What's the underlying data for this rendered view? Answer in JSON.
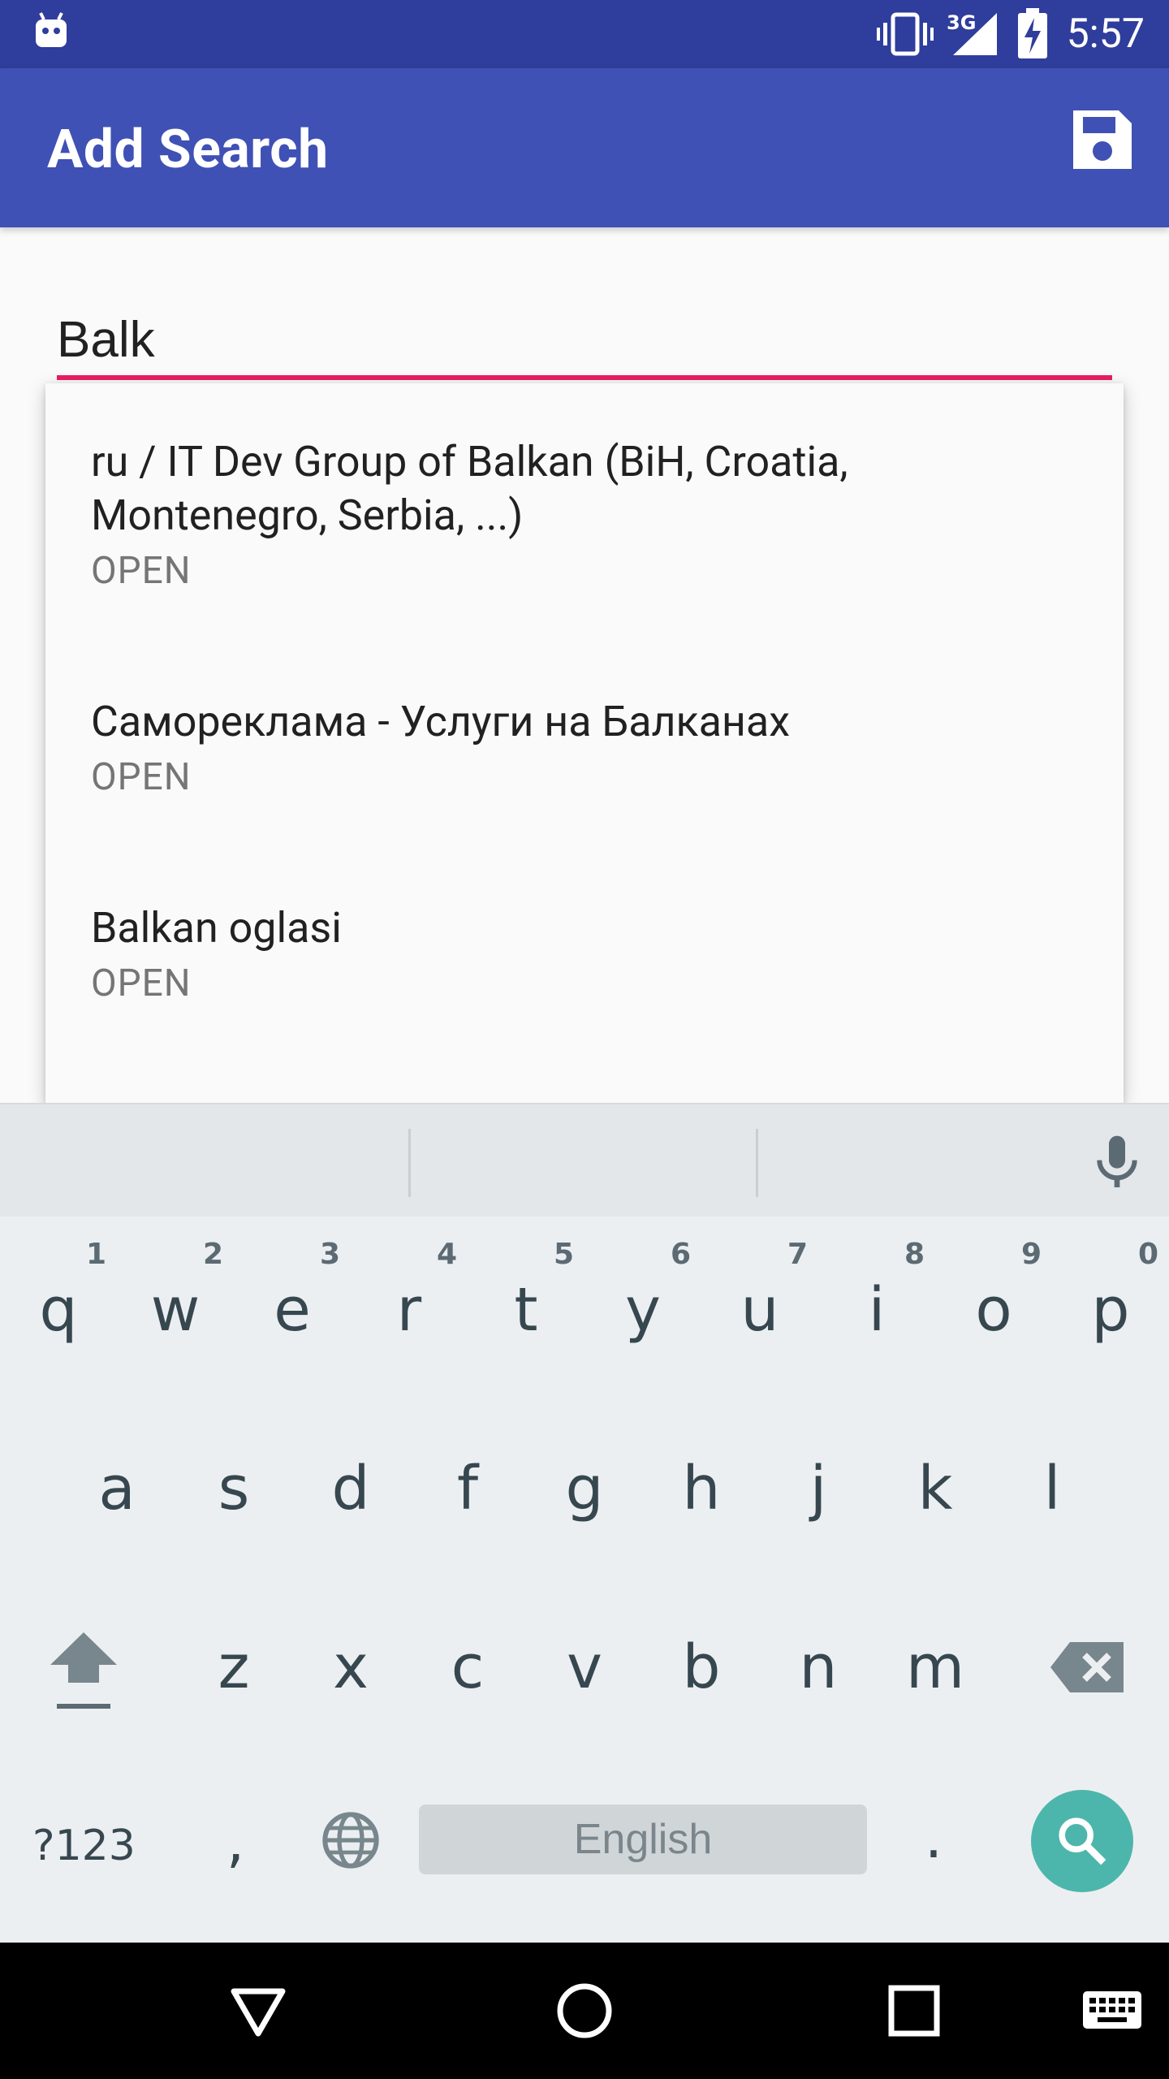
{
  "status_bar": {
    "time": "5:57",
    "network": "3G"
  },
  "app_bar": {
    "title": "Add Search",
    "save_icon": "floppy-disk-icon"
  },
  "search": {
    "value": "Balk",
    "placeholder": ""
  },
  "suggestions": [
    {
      "title_line1": "ru / IT Dev Group of Balkan (BiH, Croatia,",
      "title_line2": "Montenegro, Serbia, ...)",
      "subtitle": "OPEN"
    },
    {
      "title_line1": "Самореклама - Услуги на Балканах",
      "subtitle": "OPEN"
    },
    {
      "title_line1": "Balkan oglasi",
      "subtitle": "OPEN"
    }
  ],
  "keyboard": {
    "row1": [
      "q",
      "w",
      "e",
      "r",
      "t",
      "y",
      "u",
      "i",
      "o",
      "p"
    ],
    "row1_hints": [
      "1",
      "2",
      "3",
      "4",
      "5",
      "6",
      "7",
      "8",
      "9",
      "0"
    ],
    "row2": [
      "a",
      "s",
      "d",
      "f",
      "g",
      "h",
      "j",
      "k",
      "l"
    ],
    "row3": [
      "z",
      "x",
      "c",
      "v",
      "b",
      "n",
      "m"
    ],
    "symbols_label": "?123",
    "comma": ",",
    "space_label": "English",
    "period": ".",
    "accent_color": "#4db6ac"
  },
  "colors": {
    "primary": "#3f51b5",
    "primary_dark": "#2f3d9c",
    "accent": "#e91e63"
  }
}
